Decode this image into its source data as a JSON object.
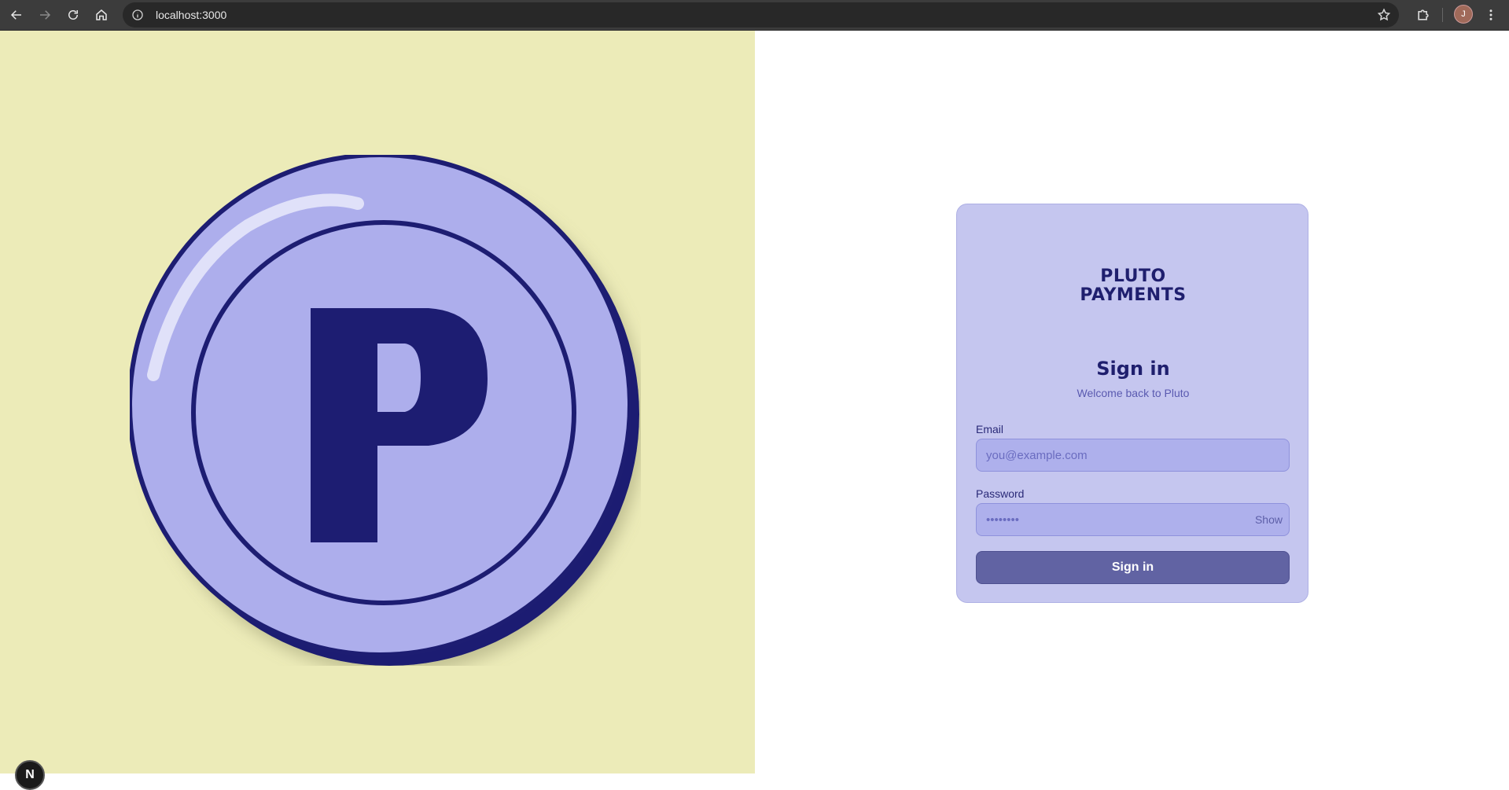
{
  "browser": {
    "url": "localhost:3000",
    "avatar_initial": "J"
  },
  "brand": {
    "line1": "PLUTO",
    "line2": "PAYMENTS",
    "coin_letter": "P"
  },
  "signin": {
    "title": "Sign in",
    "subtitle": "Welcome back to Pluto",
    "email_label": "Email",
    "email_placeholder": "you@example.com",
    "password_label": "Password",
    "password_placeholder": "••••••••",
    "show_label": "Show",
    "submit_label": "Sign in"
  },
  "dev_badge": "N",
  "colors": {
    "left_bg": "#ecebb8",
    "coin_face": "#adaeec",
    "coin_ink": "#1d1d72",
    "card_bg": "#c5c6ef",
    "button_bg": "#6163a3"
  }
}
